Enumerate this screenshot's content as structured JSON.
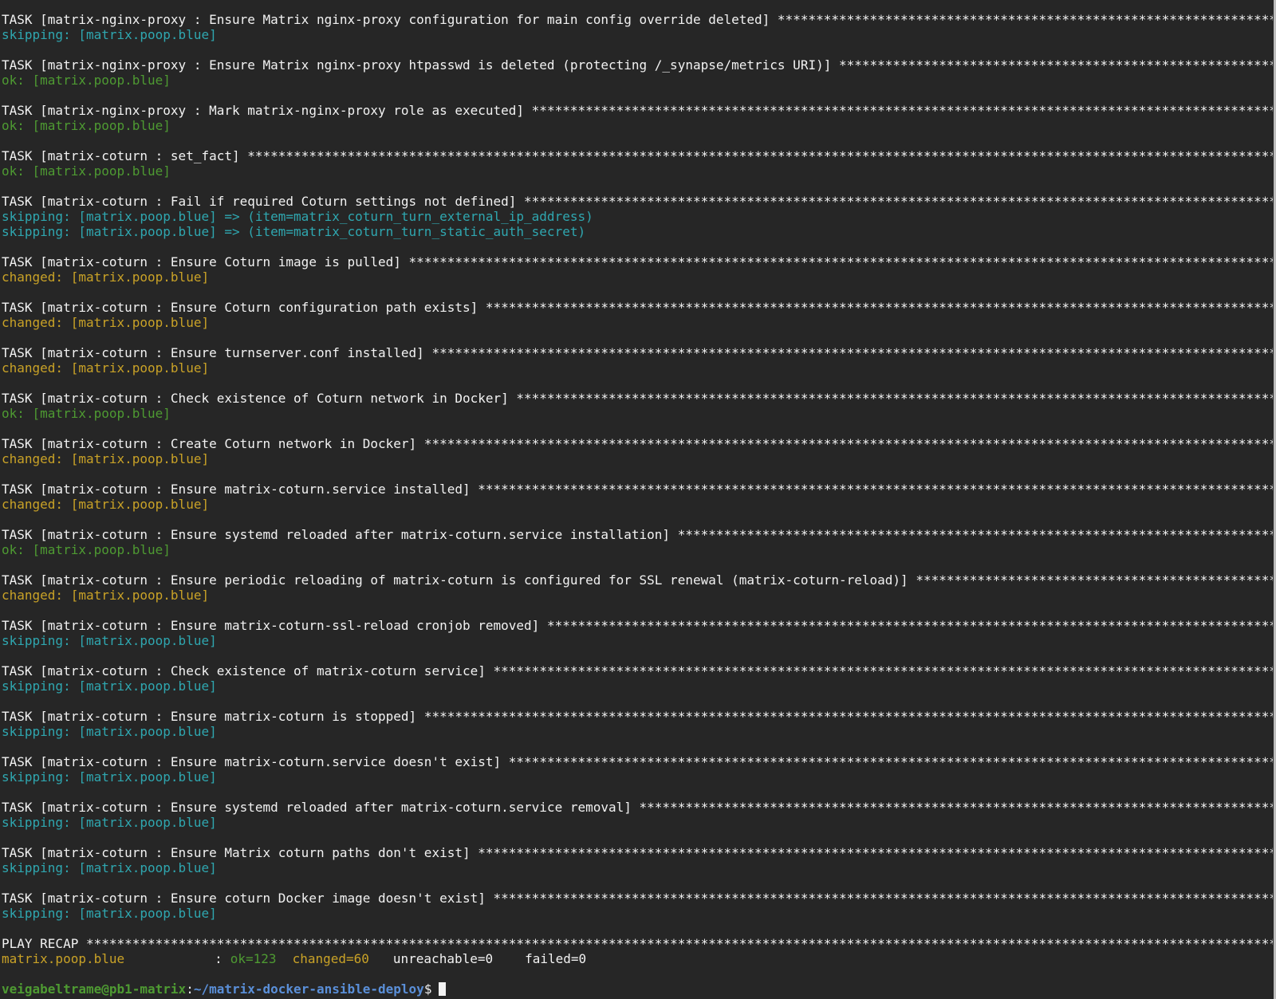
{
  "terminal": {
    "stars": "*************************************************************************************************************************************************************************",
    "tasks": [
      {
        "title": "TASK [matrix-nginx-proxy : Ensure Matrix nginx-proxy configuration for main config override deleted]",
        "results": [
          {
            "status": "skipping",
            "text": "skipping: [matrix.poop.blue]"
          }
        ]
      },
      {
        "title": "TASK [matrix-nginx-proxy : Ensure Matrix nginx-proxy htpasswd is deleted (protecting /_synapse/metrics URI)]",
        "results": [
          {
            "status": "ok",
            "text": "ok: [matrix.poop.blue]"
          }
        ]
      },
      {
        "title": "TASK [matrix-nginx-proxy : Mark matrix-nginx-proxy role as executed]",
        "results": [
          {
            "status": "ok",
            "text": "ok: [matrix.poop.blue]"
          }
        ]
      },
      {
        "title": "TASK [matrix-coturn : set_fact]",
        "results": [
          {
            "status": "ok",
            "text": "ok: [matrix.poop.blue]"
          }
        ]
      },
      {
        "title": "TASK [matrix-coturn : Fail if required Coturn settings not defined]",
        "results": [
          {
            "status": "skipping",
            "text": "skipping: [matrix.poop.blue] => (item=matrix_coturn_turn_external_ip_address)"
          },
          {
            "status": "skipping",
            "text": "skipping: [matrix.poop.blue] => (item=matrix_coturn_turn_static_auth_secret)"
          }
        ]
      },
      {
        "title": "TASK [matrix-coturn : Ensure Coturn image is pulled]",
        "results": [
          {
            "status": "changed",
            "text": "changed: [matrix.poop.blue]"
          }
        ]
      },
      {
        "title": "TASK [matrix-coturn : Ensure Coturn configuration path exists]",
        "results": [
          {
            "status": "changed",
            "text": "changed: [matrix.poop.blue]"
          }
        ]
      },
      {
        "title": "TASK [matrix-coturn : Ensure turnserver.conf installed]",
        "results": [
          {
            "status": "changed",
            "text": "changed: [matrix.poop.blue]"
          }
        ]
      },
      {
        "title": "TASK [matrix-coturn : Check existence of Coturn network in Docker]",
        "results": [
          {
            "status": "ok",
            "text": "ok: [matrix.poop.blue]"
          }
        ]
      },
      {
        "title": "TASK [matrix-coturn : Create Coturn network in Docker]",
        "results": [
          {
            "status": "changed",
            "text": "changed: [matrix.poop.blue]"
          }
        ]
      },
      {
        "title": "TASK [matrix-coturn : Ensure matrix-coturn.service installed]",
        "results": [
          {
            "status": "changed",
            "text": "changed: [matrix.poop.blue]"
          }
        ]
      },
      {
        "title": "TASK [matrix-coturn : Ensure systemd reloaded after matrix-coturn.service installation]",
        "results": [
          {
            "status": "ok",
            "text": "ok: [matrix.poop.blue]"
          }
        ]
      },
      {
        "title": "TASK [matrix-coturn : Ensure periodic reloading of matrix-coturn is configured for SSL renewal (matrix-coturn-reload)]",
        "results": [
          {
            "status": "changed",
            "text": "changed: [matrix.poop.blue]"
          }
        ]
      },
      {
        "title": "TASK [matrix-coturn : Ensure matrix-coturn-ssl-reload cronjob removed]",
        "results": [
          {
            "status": "skipping",
            "text": "skipping: [matrix.poop.blue]"
          }
        ]
      },
      {
        "title": "TASK [matrix-coturn : Check existence of matrix-coturn service]",
        "results": [
          {
            "status": "skipping",
            "text": "skipping: [matrix.poop.blue]"
          }
        ]
      },
      {
        "title": "TASK [matrix-coturn : Ensure matrix-coturn is stopped]",
        "results": [
          {
            "status": "skipping",
            "text": "skipping: [matrix.poop.blue]"
          }
        ]
      },
      {
        "title": "TASK [matrix-coturn : Ensure matrix-coturn.service doesn't exist]",
        "results": [
          {
            "status": "skipping",
            "text": "skipping: [matrix.poop.blue]"
          }
        ]
      },
      {
        "title": "TASK [matrix-coturn : Ensure systemd reloaded after matrix-coturn.service removal]",
        "results": [
          {
            "status": "skipping",
            "text": "skipping: [matrix.poop.blue]"
          }
        ]
      },
      {
        "title": "TASK [matrix-coturn : Ensure Matrix coturn paths don't exist]",
        "results": [
          {
            "status": "skipping",
            "text": "skipping: [matrix.poop.blue]"
          }
        ]
      },
      {
        "title": "TASK [matrix-coturn : Ensure coturn Docker image doesn't exist]",
        "results": [
          {
            "status": "skipping",
            "text": "skipping: [matrix.poop.blue]"
          }
        ]
      }
    ],
    "recap": {
      "title": "PLAY RECAP",
      "host": "matrix.poop.blue",
      "separator": ":",
      "ok": "ok=123",
      "changed": "changed=60",
      "unreachable": "unreachable=0",
      "failed": "failed=0"
    },
    "prompt": {
      "user_host": "veigabeltrame@pb1-matrix",
      "colon": ":",
      "path": "~/matrix-docker-ansible-deploy",
      "symbol": "$"
    },
    "colors": {
      "background": "#262626",
      "ok": "#4e9a32",
      "changed": "#c9a227",
      "skipping": "#2fa7b0",
      "path": "#5a8fd8"
    }
  }
}
